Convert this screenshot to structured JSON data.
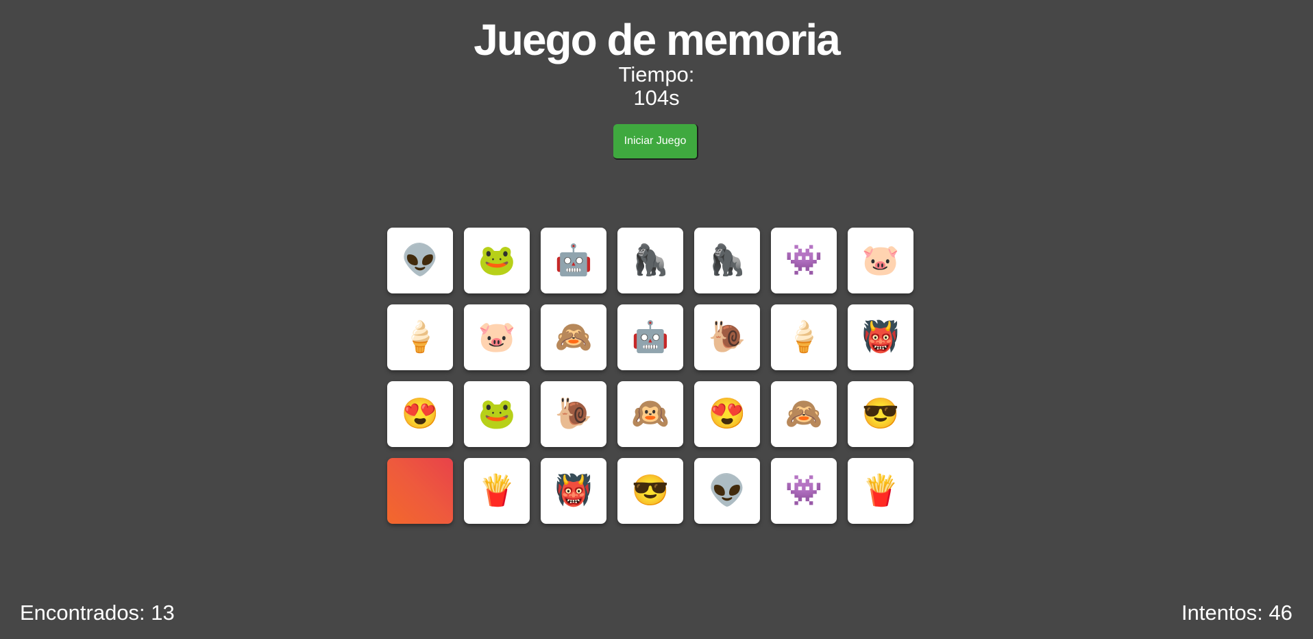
{
  "header": {
    "title": "Juego de memoria",
    "timer_label": "Tiempo:",
    "timer_value": "104s"
  },
  "controls": {
    "start_label": "Iniciar Juego"
  },
  "board": {
    "columns": 7,
    "cards": [
      {
        "icon": "alien-icon",
        "glyph": "👽",
        "state": "face-up"
      },
      {
        "icon": "frog-icon",
        "glyph": "🐸",
        "state": "face-up"
      },
      {
        "icon": "robot-icon",
        "glyph": "🤖",
        "state": "face-up"
      },
      {
        "icon": "gorilla-icon",
        "glyph": "🦍",
        "state": "face-up"
      },
      {
        "icon": "gorilla-icon",
        "glyph": "🦍",
        "state": "face-up"
      },
      {
        "icon": "space-invader-icon",
        "glyph": "👾",
        "state": "face-up"
      },
      {
        "icon": "pig-icon",
        "glyph": "🐷",
        "state": "face-up"
      },
      {
        "icon": "ice-cream-icon",
        "glyph": "🍦",
        "state": "face-up"
      },
      {
        "icon": "pig-icon",
        "glyph": "🐷",
        "state": "face-up"
      },
      {
        "icon": "see-no-evil-monkey-icon",
        "glyph": "🙈",
        "state": "face-up"
      },
      {
        "icon": "robot-icon",
        "glyph": "🤖",
        "state": "face-up"
      },
      {
        "icon": "snail-icon",
        "glyph": "🐌",
        "state": "face-up"
      },
      {
        "icon": "ice-cream-icon",
        "glyph": "🍦",
        "state": "face-up"
      },
      {
        "icon": "monster-icon",
        "glyph": "👹",
        "state": "face-up"
      },
      {
        "icon": "heart-eyes-face-icon",
        "glyph": "😍",
        "state": "face-up"
      },
      {
        "icon": "frog-icon",
        "glyph": "🐸",
        "state": "face-up"
      },
      {
        "icon": "snail-icon",
        "glyph": "🐌",
        "state": "face-up"
      },
      {
        "icon": "hear-no-evil-monkey-icon",
        "glyph": "🙉",
        "state": "face-up"
      },
      {
        "icon": "heart-eyes-face-icon",
        "glyph": "😍",
        "state": "face-up"
      },
      {
        "icon": "see-no-evil-monkey-icon",
        "glyph": "🙈",
        "state": "face-up"
      },
      {
        "icon": "sunglasses-face-icon",
        "glyph": "😎",
        "state": "face-up"
      },
      {
        "icon": "card-back",
        "glyph": "",
        "state": "face-down"
      },
      {
        "icon": "french-fries-icon",
        "glyph": "🍟",
        "state": "face-up"
      },
      {
        "icon": "monster-icon",
        "glyph": "👹",
        "state": "face-up"
      },
      {
        "icon": "sunglasses-face-icon",
        "glyph": "😎",
        "state": "face-up"
      },
      {
        "icon": "alien-icon",
        "glyph": "👽",
        "state": "face-up"
      },
      {
        "icon": "space-invader-icon",
        "glyph": "👾",
        "state": "face-up"
      },
      {
        "icon": "french-fries-icon",
        "glyph": "🍟",
        "state": "face-up"
      }
    ]
  },
  "stats": {
    "found_text": "Encontrados: 13",
    "attempts_text": "Intentos: 46"
  },
  "colors": {
    "background": "#474747",
    "button": "#3fa93f",
    "card_face": "#ffffff",
    "card_back_start": "#f3682c",
    "card_back_end": "#e8424a"
  }
}
